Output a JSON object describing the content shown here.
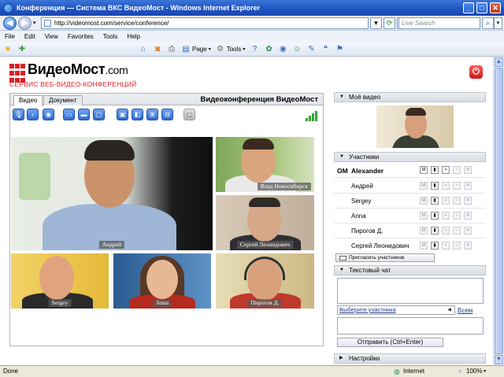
{
  "window": {
    "title": "Конференция — Система ВКС ВидеоМост - Windows Internet Explorer",
    "minimize": "_",
    "maximize": "□",
    "close": "✕"
  },
  "address": {
    "url": "http://videomost.com/service/conference/",
    "search_placeholder": "Live Search"
  },
  "menu": [
    "File",
    "Edit",
    "View",
    "Favorites",
    "Tools",
    "Help"
  ],
  "toolbar": {
    "page_label": "Page",
    "tools_label": "Tools"
  },
  "logo": {
    "name": "ВидеоМост",
    "suffix": ".com",
    "tagline": "СЕРВИС ВЕБ-ВИДЕО-КОНФЕРЕНЦИЙ"
  },
  "video_panel": {
    "tabs": [
      "Видео",
      "Документ"
    ],
    "active_tab": "Видео",
    "title": "Видеоконференция ВидеоМост",
    "tiles": [
      {
        "label": "Андрей",
        "bg": "#dfe5dc",
        "skin": "#c9926a",
        "shirt": "#9fb6d6"
      },
      {
        "label": "Влад Новосибирск",
        "bg": "#8bb05a",
        "skin": "#d9a57d",
        "shirt": "#e8e8e8"
      },
      {
        "label": "Сергей Леонидович",
        "bg": "#c8b9a8",
        "skin": "#d7a78a",
        "shirt": "#2e2e33"
      },
      {
        "label": "Sergey",
        "bg": "#e7c04a",
        "skin": "#e0a37e",
        "shirt": "#2a2a2a"
      },
      {
        "label": "Anna",
        "bg": "#3b6fa6",
        "skin": "#e7b894",
        "shirt": "#b52a1e"
      },
      {
        "label": "Пирогов Д.",
        "bg": "#d8c99a",
        "skin": "#d9a07c",
        "shirt": "#c0392b"
      }
    ]
  },
  "sections": {
    "my_video": "Моё видео",
    "participants": "Участники",
    "chat": "Текстовый чат",
    "settings": "Настройки"
  },
  "participants": {
    "me": {
      "badge": "OM",
      "name": "Alexander"
    },
    "others": [
      "Андрей",
      "Sergey",
      "Anna",
      "Пирогов Д.",
      "Сергей Леонидович"
    ],
    "invite_label": "Пригласить участников"
  },
  "chat": {
    "select_label": "Выберите участника",
    "all_label": "Всем",
    "send_label": "Отправить (Ctrl+Enter)"
  },
  "status": {
    "left": "Done",
    "zone": "Internet",
    "zoom": "100%"
  }
}
